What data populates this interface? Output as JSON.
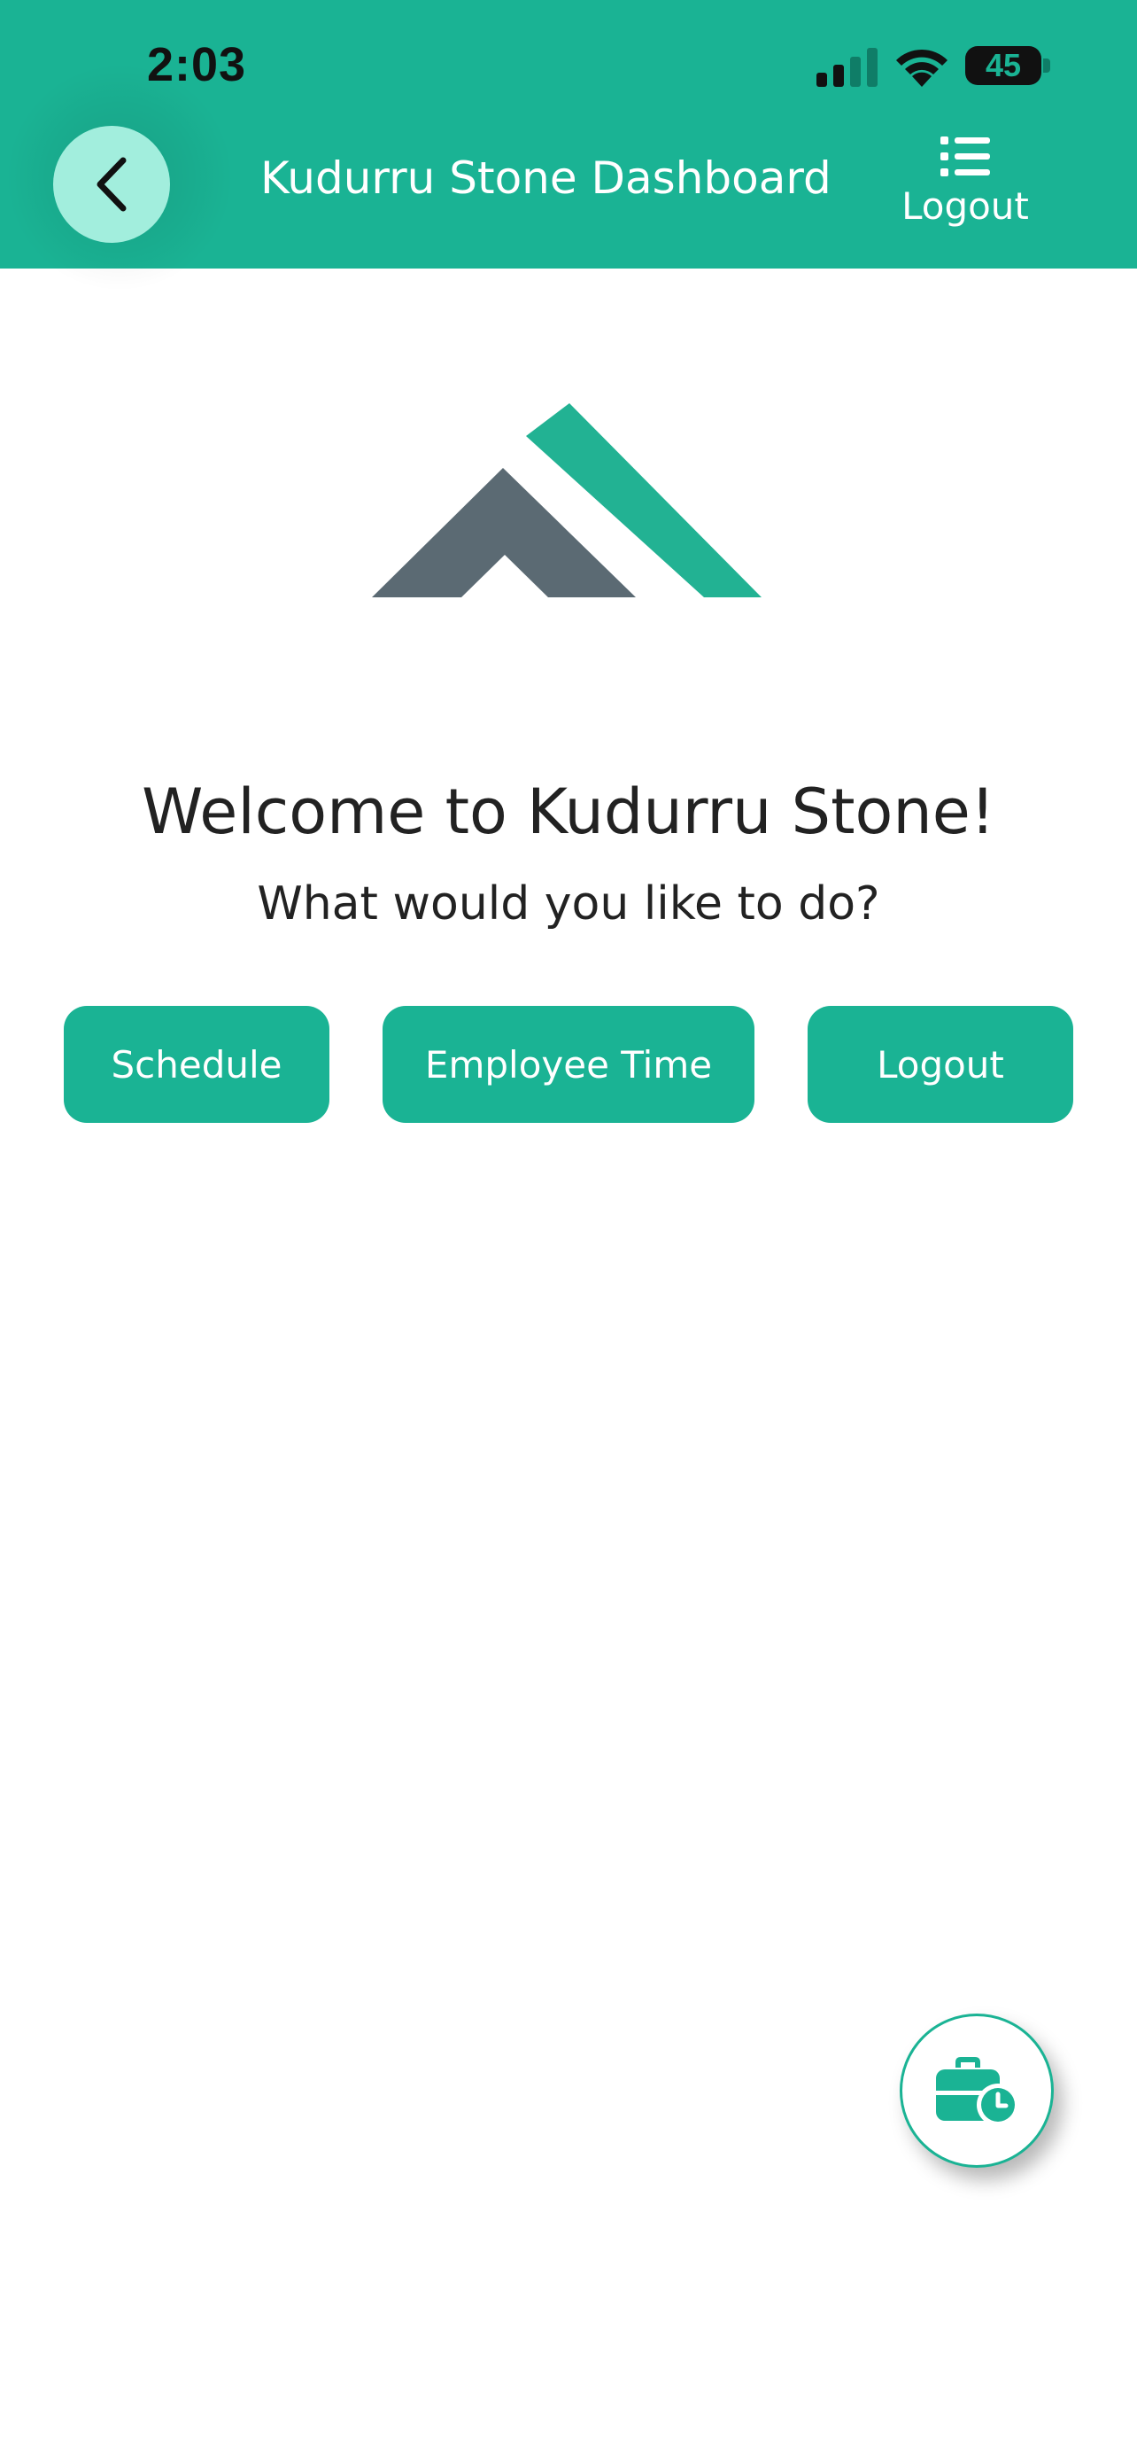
{
  "status_bar": {
    "time": "2:03",
    "battery": "45",
    "signal_icon": "cellular-signal-icon",
    "wifi_icon": "wifi-icon"
  },
  "header": {
    "back_icon": "chevron-left-icon",
    "title": "Kudurru Stone Dashboard",
    "menu_icon": "list-icon",
    "menu_label": "Logout"
  },
  "logo": {
    "icon": "kudurru-stone-logo-icon",
    "colors": {
      "dark": "#5b6a73",
      "accent": "#22b293"
    }
  },
  "welcome": {
    "title": "Welcome to Kudurru Stone!",
    "subtitle": "What would you like to do?"
  },
  "actions": [
    {
      "label": "Schedule"
    },
    {
      "label": "Employee Time"
    },
    {
      "label": "Logout"
    }
  ],
  "fab": {
    "icon": "briefcase-clock-icon"
  },
  "theme": {
    "primary": "#1ab394",
    "back_button": "#a2eedd",
    "text": "#222222"
  }
}
